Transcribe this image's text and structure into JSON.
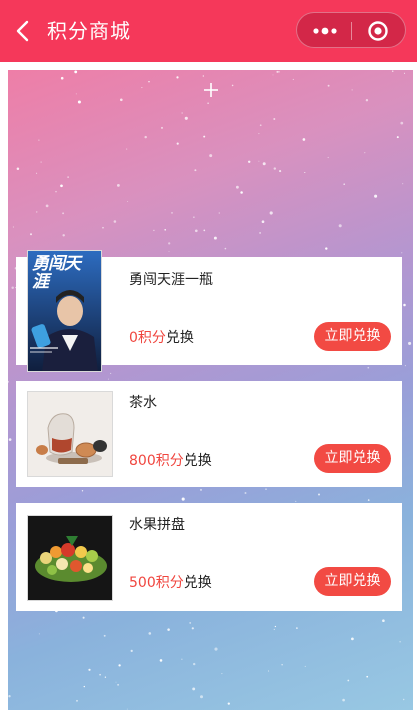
{
  "header": {
    "title": "积分商城",
    "back_icon": "chevron-left-icon",
    "more_icon": "more-dots-icon",
    "close_icon": "target-circle-icon",
    "background_color": "#f5385a"
  },
  "content": {
    "add_icon": "plus-icon"
  },
  "products": [
    {
      "name": "勇闯天涯一瓶",
      "points": "0积分",
      "suffix": "兑换",
      "button": "立即兑换",
      "image_icon": "beer-poster-image",
      "poster_text": "勇闯天涯"
    },
    {
      "name": "茶水",
      "points": "800积分",
      "suffix": "兑换",
      "button": "立即兑换",
      "image_icon": "tea-set-image"
    },
    {
      "name": "水果拼盘",
      "points": "500积分",
      "suffix": "兑换",
      "button": "立即兑换",
      "image_icon": "fruit-platter-image"
    }
  ],
  "colors": {
    "accent": "#f24a43",
    "points_text": "#f0463f"
  }
}
